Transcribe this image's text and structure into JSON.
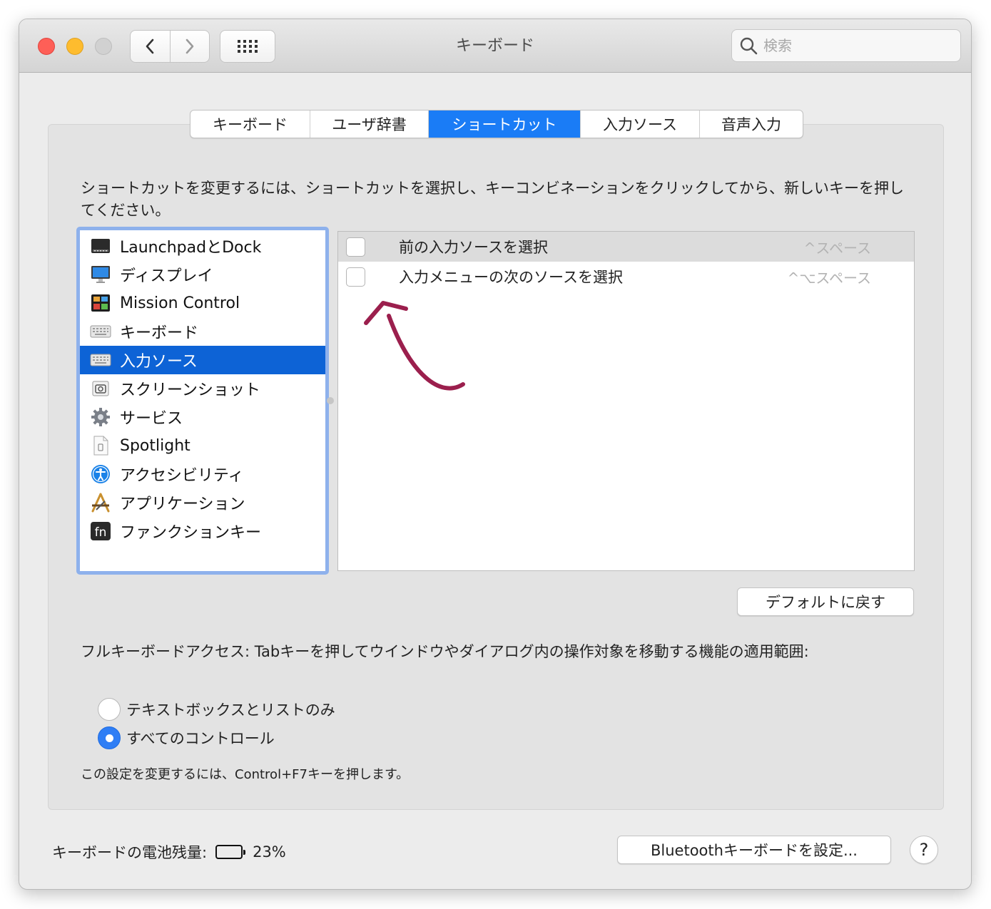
{
  "window": {
    "title": "キーボード"
  },
  "search": {
    "placeholder": "検索"
  },
  "tabs": [
    {
      "label": "キーボード",
      "active": false
    },
    {
      "label": "ユーザ辞書",
      "active": false
    },
    {
      "label": "ショートカット",
      "active": true
    },
    {
      "label": "入力ソース",
      "active": false
    },
    {
      "label": "音声入力",
      "active": false
    }
  ],
  "instructions": "ショートカットを変更するには、ショートカットを選択し、キーコンビネーションをクリックしてから、新しいキーを押してください。",
  "categories": [
    {
      "label": "LaunchpadとDock",
      "icon": "launchpad-dock-icon"
    },
    {
      "label": "ディスプレイ",
      "icon": "display-icon"
    },
    {
      "label": "Mission Control",
      "icon": "mission-control-icon"
    },
    {
      "label": "キーボード",
      "icon": "keyboard-icon"
    },
    {
      "label": "入力ソース",
      "icon": "input-source-keyboard-icon",
      "selected": true
    },
    {
      "label": "スクリーンショット",
      "icon": "screenshot-icon"
    },
    {
      "label": "サービス",
      "icon": "services-gear-icon"
    },
    {
      "label": "Spotlight",
      "icon": "spotlight-document-icon"
    },
    {
      "label": "アクセシビリティ",
      "icon": "accessibility-icon"
    },
    {
      "label": "アプリケーション",
      "icon": "applications-icon"
    },
    {
      "label": "ファンクションキー",
      "icon": "fn-key-icon"
    }
  ],
  "shortcuts": [
    {
      "label": "前の入力ソースを選択",
      "keys": "^スペース",
      "checked": false
    },
    {
      "label": "入力メニューの次のソースを選択",
      "keys": "^⌥スペース",
      "checked": false
    }
  ],
  "buttons": {
    "restore_defaults": "デフォルトに戻す",
    "bluetooth": "Bluetoothキーボードを設定...",
    "help": "?"
  },
  "full_keyboard_access": {
    "label": "フルキーボードアクセス: Tabキーを押してウインドウやダイアログ内の操作対象を移動する機能の適用範囲:",
    "options": [
      {
        "label": "テキストボックスとリストのみ",
        "selected": false
      },
      {
        "label": "すべてのコントロール",
        "selected": true
      }
    ],
    "note": "この設定を変更するには、Control+F7キーを押します。"
  },
  "battery": {
    "label": "キーボードの電池残量:",
    "value": "23%",
    "level": 0.23
  },
  "colors": {
    "accent": "#1a7cf6",
    "selection": "#0d63d6",
    "annotation_arrow": "#9b1f4d"
  }
}
